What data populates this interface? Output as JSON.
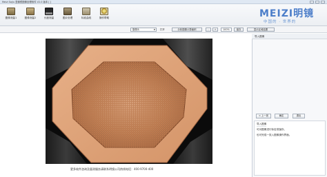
{
  "window": {
    "title": "Meizi Sojiu 显微镜图像处理软件 V2.0 版本 [ ]"
  },
  "ribbon": {
    "buttons": [
      {
        "label": "图像测量1",
        "icon": "microscope-image-icon"
      },
      {
        "label": "图像测量2",
        "icon": "image-measure-icon"
      },
      {
        "label": "长度测量",
        "icon": "monitor-icon"
      },
      {
        "label": "图片处理",
        "icon": "photo-process-icon"
      },
      {
        "label": "标准曲线",
        "icon": "curve-icon"
      },
      {
        "label": "操作帮助",
        "icon": "help-icon"
      }
    ]
  },
  "brand": {
    "mark": "MEIZI明镜",
    "tagline": "中国的 · 世界的"
  },
  "toolbar": {
    "camera_select": "摄像头",
    "open_label": "打开",
    "capture_button": "分析图像计算面积",
    "zoom_level": "100%",
    "zoom_out": "-",
    "zoom_in": "+",
    "save_button": "保存",
    "report_button": "显示区域结果"
  },
  "panel": {
    "title": "导入图像",
    "prev_button": "< 上一张",
    "next_button": "确定",
    "third_button": "退出",
    "info_title": "导入图像",
    "info_lines": [
      "可对图像进行标定或保存，",
      "也可完成一张入图像操作界面。"
    ]
  },
  "viewer": {
    "caption": "更多软件咨询及量测服务请联系明镜公司热线电话：400-9700-400"
  },
  "colors": {
    "accent": "#4c7ec9",
    "copper": "#d39a6f",
    "background": "#0c0c0c"
  }
}
